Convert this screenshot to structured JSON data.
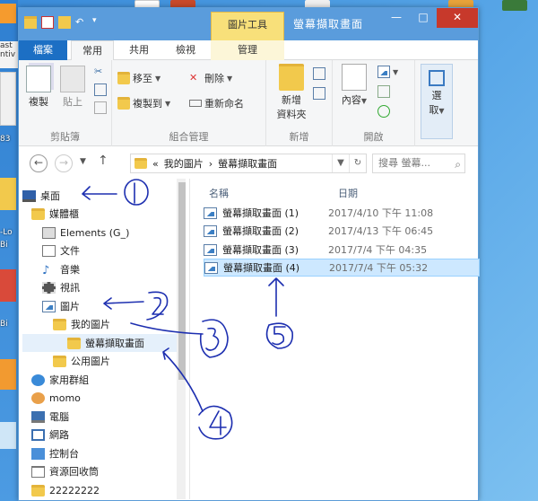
{
  "window": {
    "title": "螢幕擷取畫面",
    "context_tab": "圖片工具"
  },
  "tabs": [
    {
      "label": "檔案"
    },
    {
      "label": "常用"
    },
    {
      "label": "共用"
    },
    {
      "label": "檢視"
    },
    {
      "label": "管理"
    }
  ],
  "ribbon": {
    "copy": "複製",
    "paste": "貼上",
    "clipboard_group": "剪貼簿",
    "move_to": "移至",
    "copy_to": "複製到",
    "delete": "刪除",
    "rename": "重新命名",
    "organize_group": "組合管理",
    "new_folder_line1": "新增",
    "new_folder_line2": "資料夾",
    "new_group": "新增",
    "properties": "內容",
    "open_group": "開啟",
    "select_line1": "選",
    "select_line2": "取"
  },
  "address": {
    "prefix": "«",
    "segments": [
      "我的圖片",
      "螢幕擷取畫面"
    ],
    "search_placeholder": "搜尋 螢幕..."
  },
  "nav": [
    {
      "label": "桌面"
    },
    {
      "label": "媒體櫃"
    },
    {
      "label": "Elements (G_)"
    },
    {
      "label": "文件"
    },
    {
      "label": "音樂"
    },
    {
      "label": "視訊"
    },
    {
      "label": "圖片"
    },
    {
      "label": "我的圖片"
    },
    {
      "label": "螢幕擷取畫面"
    },
    {
      "label": "公用圖片"
    },
    {
      "label": "家用群組"
    },
    {
      "label": "momo"
    },
    {
      "label": "電腦"
    },
    {
      "label": "網路"
    },
    {
      "label": "控制台"
    },
    {
      "label": "資源回收筒"
    },
    {
      "label": "22222222"
    }
  ],
  "columns": {
    "name": "名稱",
    "date": "日期"
  },
  "files": [
    {
      "name": "螢幕擷取畫面 (1)",
      "date": "2017/4/10 下午 11:08"
    },
    {
      "name": "螢幕擷取畫面 (2)",
      "date": "2017/4/13 下午 06:45"
    },
    {
      "name": "螢幕擷取畫面 (3)",
      "date": "2017/7/4 下午 04:35"
    },
    {
      "name": "螢幕擷取畫面 (4)",
      "date": "2017/7/4 下午 05:32"
    }
  ],
  "desktop": {
    "fragments": [
      "ast",
      "ntiv",
      "83",
      "-Lo",
      "Bi",
      "Bi"
    ]
  },
  "colors": {
    "titlebar": "#5a9cdc",
    "file_tab": "#1c6fc4",
    "context_tab": "#f8e07a",
    "close": "#c7392b",
    "selection": "#cde8ff",
    "annotation_ink": "#1d2fb0"
  }
}
